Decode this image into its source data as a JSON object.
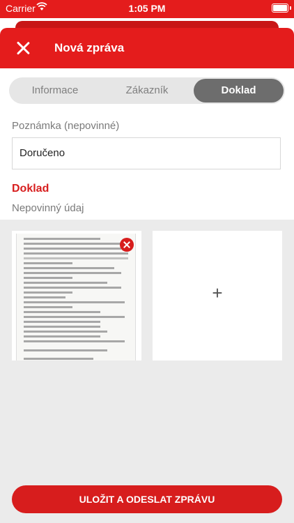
{
  "status_bar": {
    "carrier": "Carrier",
    "time": "1:05 PM"
  },
  "header": {
    "title": "Nová zpráva"
  },
  "tabs": [
    {
      "label": "Informace",
      "selected": false
    },
    {
      "label": "Zákazník",
      "selected": false
    },
    {
      "label": "Doklad",
      "selected": true
    }
  ],
  "note": {
    "label": "Poznámka (nepovinné)",
    "value": "Doručeno"
  },
  "document": {
    "title": "Doklad",
    "subtitle": "Nepovinný údaj",
    "add_symbol": "+"
  },
  "submit_label": "ULOŽIT A ODESLAT ZPRÁVU",
  "colors": {
    "accent": "#e41c1c",
    "tab_selected": "#6d6d6d"
  }
}
